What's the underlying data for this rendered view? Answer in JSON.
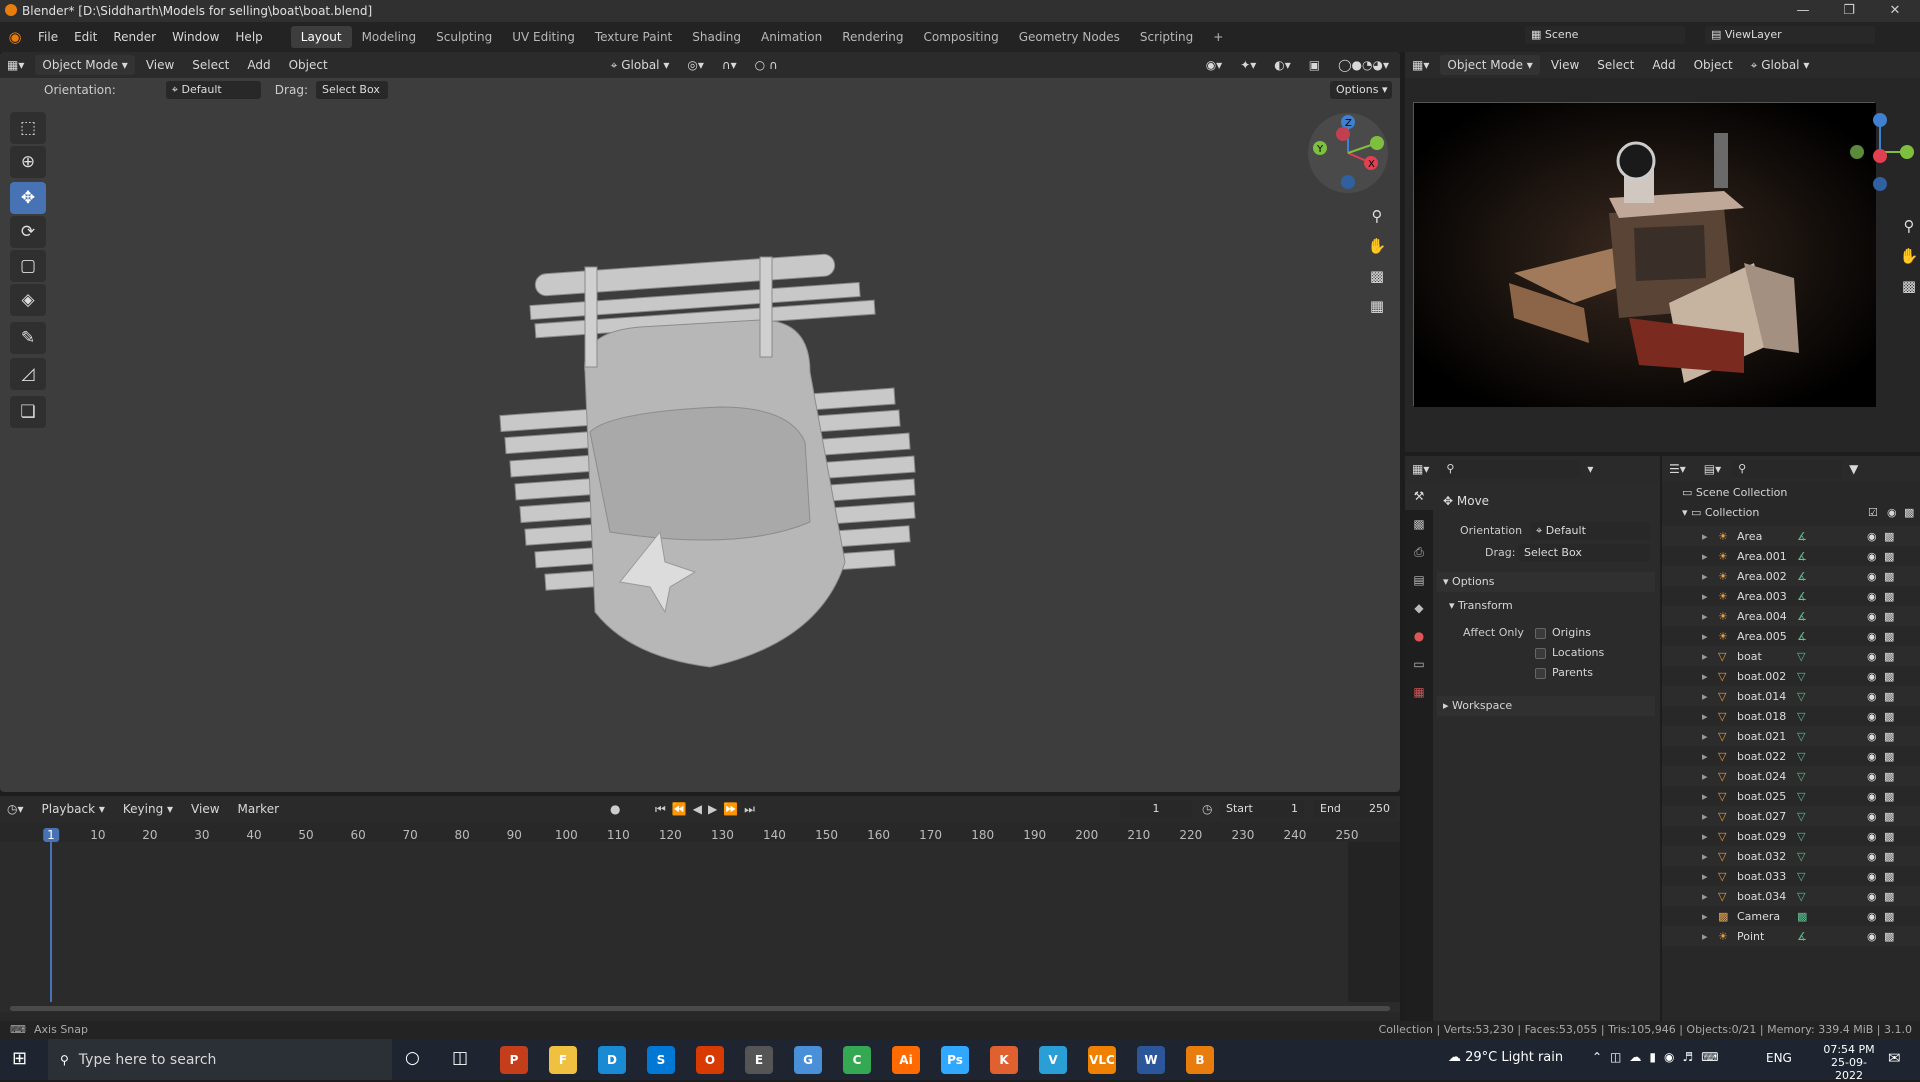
{
  "window": {
    "title": "Blender* [D:\\Siddharth\\Models for selling\\boat\\boat.blend]"
  },
  "menubar": {
    "items": [
      "File",
      "Edit",
      "Render",
      "Window",
      "Help"
    ]
  },
  "workspaces": {
    "tabs": [
      "Layout",
      "Modeling",
      "Sculpting",
      "UV Editing",
      "Texture Paint",
      "Shading",
      "Animation",
      "Rendering",
      "Compositing",
      "Geometry Nodes",
      "Scripting"
    ],
    "active": "Layout"
  },
  "scene": {
    "scene_name": "Scene",
    "view_layer": "ViewLayer"
  },
  "viewport_header": {
    "mode": "Object Mode",
    "menus": [
      "View",
      "Select",
      "Add",
      "Object"
    ],
    "transform": "Global"
  },
  "tool_header": {
    "orientation_label": "Orientation:",
    "orientation_value": "Default",
    "drag_label": "Drag:",
    "drag_value": "Select Box",
    "options": "Options"
  },
  "render_header": {
    "mode": "Object Mode",
    "menus": [
      "View",
      "Select",
      "Add",
      "Object"
    ],
    "transform": "Global"
  },
  "timeline": {
    "menus": [
      "Playback",
      "Keying",
      "View",
      "Marker"
    ],
    "current_frame": "1",
    "start_label": "Start",
    "start": "1",
    "end_label": "End",
    "end": "250",
    "ticks": [
      "1",
      "10",
      "20",
      "30",
      "40",
      "50",
      "60",
      "70",
      "80",
      "90",
      "100",
      "110",
      "120",
      "130",
      "140",
      "150",
      "160",
      "170",
      "180",
      "190",
      "200",
      "210",
      "220",
      "230",
      "240",
      "250"
    ]
  },
  "properties": {
    "tool": "Move",
    "orientation_label": "Orientation",
    "orientation_value": "Default",
    "drag_label": "Drag:",
    "drag_value": "Select Box",
    "options_panel": "Options",
    "transform_panel": "Transform",
    "affect_only": "Affect Only",
    "checks": [
      "Origins",
      "Locations",
      "Parents"
    ],
    "workspace_panel": "Workspace"
  },
  "outliner": {
    "scene_collection": "Scene Collection",
    "collection": "Collection",
    "items": [
      {
        "name": "Area",
        "kind": "light"
      },
      {
        "name": "Area.001",
        "kind": "light"
      },
      {
        "name": "Area.002",
        "kind": "light"
      },
      {
        "name": "Area.003",
        "kind": "light"
      },
      {
        "name": "Area.004",
        "kind": "light"
      },
      {
        "name": "Area.005",
        "kind": "light"
      },
      {
        "name": "boat",
        "kind": "mesh"
      },
      {
        "name": "boat.002",
        "kind": "mesh"
      },
      {
        "name": "boat.014",
        "kind": "mesh"
      },
      {
        "name": "boat.018",
        "kind": "mesh"
      },
      {
        "name": "boat.021",
        "kind": "mesh"
      },
      {
        "name": "boat.022",
        "kind": "mesh"
      },
      {
        "name": "boat.024",
        "kind": "mesh"
      },
      {
        "name": "boat.025",
        "kind": "mesh"
      },
      {
        "name": "boat.027",
        "kind": "mesh"
      },
      {
        "name": "boat.029",
        "kind": "mesh"
      },
      {
        "name": "boat.032",
        "kind": "mesh"
      },
      {
        "name": "boat.033",
        "kind": "mesh"
      },
      {
        "name": "boat.034",
        "kind": "mesh"
      },
      {
        "name": "Camera",
        "kind": "camera"
      },
      {
        "name": "Point",
        "kind": "light"
      }
    ]
  },
  "status": {
    "left": "Axis Snap",
    "right": "Collection | Verts:53,230 | Faces:53,055 | Tris:105,946 | Objects:0/21 | Memory: 339.4 MiB | 3.1.0"
  },
  "taskbar": {
    "search_placeholder": "Type here to search",
    "weather": "29°C  Light rain",
    "lang": "ENG",
    "time": "07:54 PM",
    "date": "25-09-2022",
    "apps": [
      "P",
      "F",
      "D",
      "S",
      "O",
      "E",
      "G",
      "C",
      "Ai",
      "Ps",
      "K",
      "V",
      "VLC",
      "W",
      "B"
    ]
  },
  "colors": {
    "accent": "#4772b3",
    "blender_orange": "#e87d0d",
    "mesh_green": "#5fbf8f",
    "gizmo_x": "#e04050",
    "gizmo_y": "#7fbf3f",
    "gizmo_z": "#3f80d0"
  }
}
